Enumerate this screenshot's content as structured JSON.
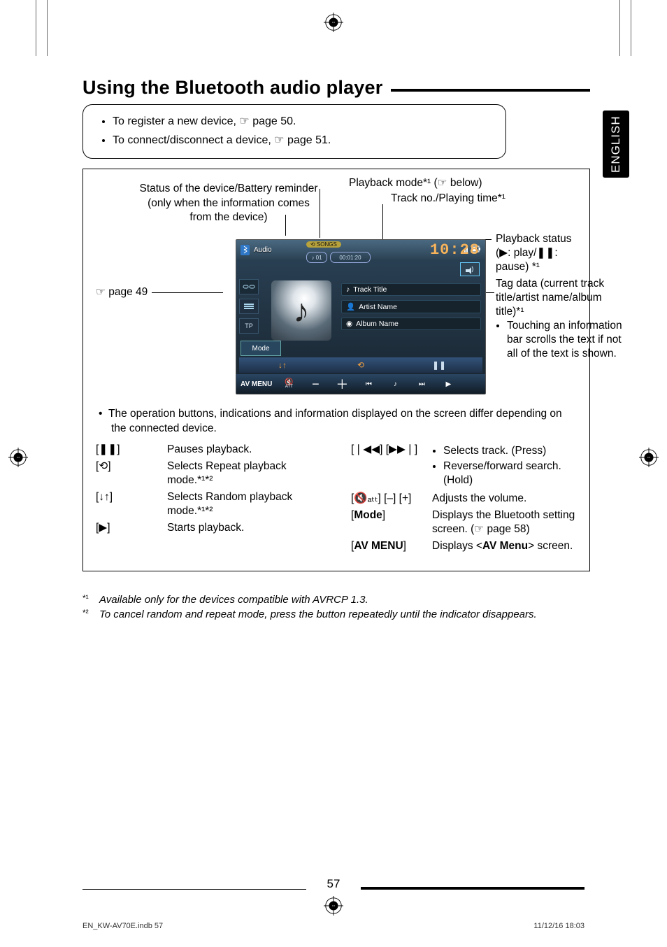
{
  "page": {
    "language_tab": "ENGLISH",
    "section_title": "Using the Bluetooth audio player",
    "intro_bullets": [
      "To register a new device, ☞ page 50.",
      "To connect/disconnect a device, ☞ page 51."
    ],
    "page_ref_49": "☞ page 49",
    "callouts": {
      "status_label": "Status of the device/Battery reminder (only when the information comes from the device)",
      "playback_mode": "Playback mode*¹ (☞ below)",
      "trackno_time": "Track no./Playing time*¹",
      "playback_status": "Playback status",
      "playback_status_sub": "(▶: play/❚❚: pause) *¹",
      "tag_data": "Tag data (current track title/artist name/album title)*¹",
      "tag_scroll_bullet": "Touching an information bar scrolls the text if not all of the text is shown."
    },
    "screenshot": {
      "source_label": "Audio",
      "songs_chip": "⟲ SONGS",
      "track_no": "♪ 01",
      "playing_time": "00:01:20",
      "clock": "10:28",
      "track_title": "Track Title",
      "artist_name": "Artist Name",
      "album_name": "Album Name",
      "mode_btn": "Mode",
      "avmenu_label": "AV MENU",
      "sidebar_tp": "TP",
      "att_label": "ATT"
    },
    "ops_note": "The operation buttons, indications and information displayed on the screen differ depending on the connected device.",
    "controls_left": [
      {
        "key": "[❚❚]",
        "desc": "Pauses playback."
      },
      {
        "key": "[⟲]",
        "desc": "Selects Repeat playback mode.*¹*²"
      },
      {
        "key": "[↓↑]",
        "desc": "Selects Random playback mode.*¹*²"
      },
      {
        "key": "[▶]",
        "desc": "Starts playback."
      }
    ],
    "controls_right": [
      {
        "key": "[❘◀◀] [▶▶❘]",
        "bullets": [
          "Selects track. (Press)",
          "Reverse/forward search. (Hold)"
        ]
      },
      {
        "key": "[🔇ₐₜₜ] [–] [+]",
        "desc": "Adjusts the volume."
      },
      {
        "key_html": "[<b>Mode</b>]",
        "desc": "Displays the Bluetooth setting screen. (☞ page 58)"
      },
      {
        "key_html": "[<b>AV MENU</b>]",
        "desc_html": "Displays <<b>AV Menu</b>> screen."
      }
    ],
    "footnotes": [
      {
        "mark": "*¹",
        "text": "Available only for the devices compatible with AVRCP 1.3."
      },
      {
        "mark": "*²",
        "text": "To cancel random and repeat mode, press the button repeatedly until the indicator disappears."
      }
    ],
    "page_number": "57",
    "footer_left": "EN_KW-AV70E.indb   57",
    "footer_right": "11/12/16   18:03"
  }
}
